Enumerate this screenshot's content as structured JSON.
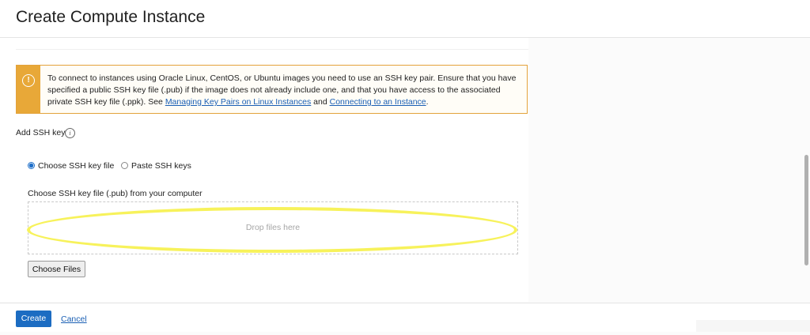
{
  "header": {
    "title": "Create Compute Instance"
  },
  "alert": {
    "icon": "warning-icon",
    "text_before": "To connect to instances using Oracle Linux, CentOS, or Ubuntu images you need to use an SSH key pair. Ensure that you have specified a public SSH key file (.pub) if the image does not already include one, and that you have access to the associated private SSH key file (.ppk). See ",
    "link1": "Managing Key Pairs on Linux Instances",
    "text_middle": " and ",
    "link2": "Connecting to an Instance",
    "text_after": "."
  },
  "ssh": {
    "label": "Add SSH key",
    "info_icon": "info-icon",
    "options": [
      {
        "label": "Choose SSH key file",
        "selected": true
      },
      {
        "label": "Paste SSH keys",
        "selected": false
      }
    ],
    "file_caption": "Choose SSH key file (.pub) from your computer",
    "drop_text": "Drop files here",
    "choose_button": "Choose Files"
  },
  "footer": {
    "create_label": "Create",
    "cancel_label": "Cancel"
  },
  "colors": {
    "accent": "#1c6cc2",
    "warning": "#e8a838",
    "highlight": "#f7f25b"
  }
}
